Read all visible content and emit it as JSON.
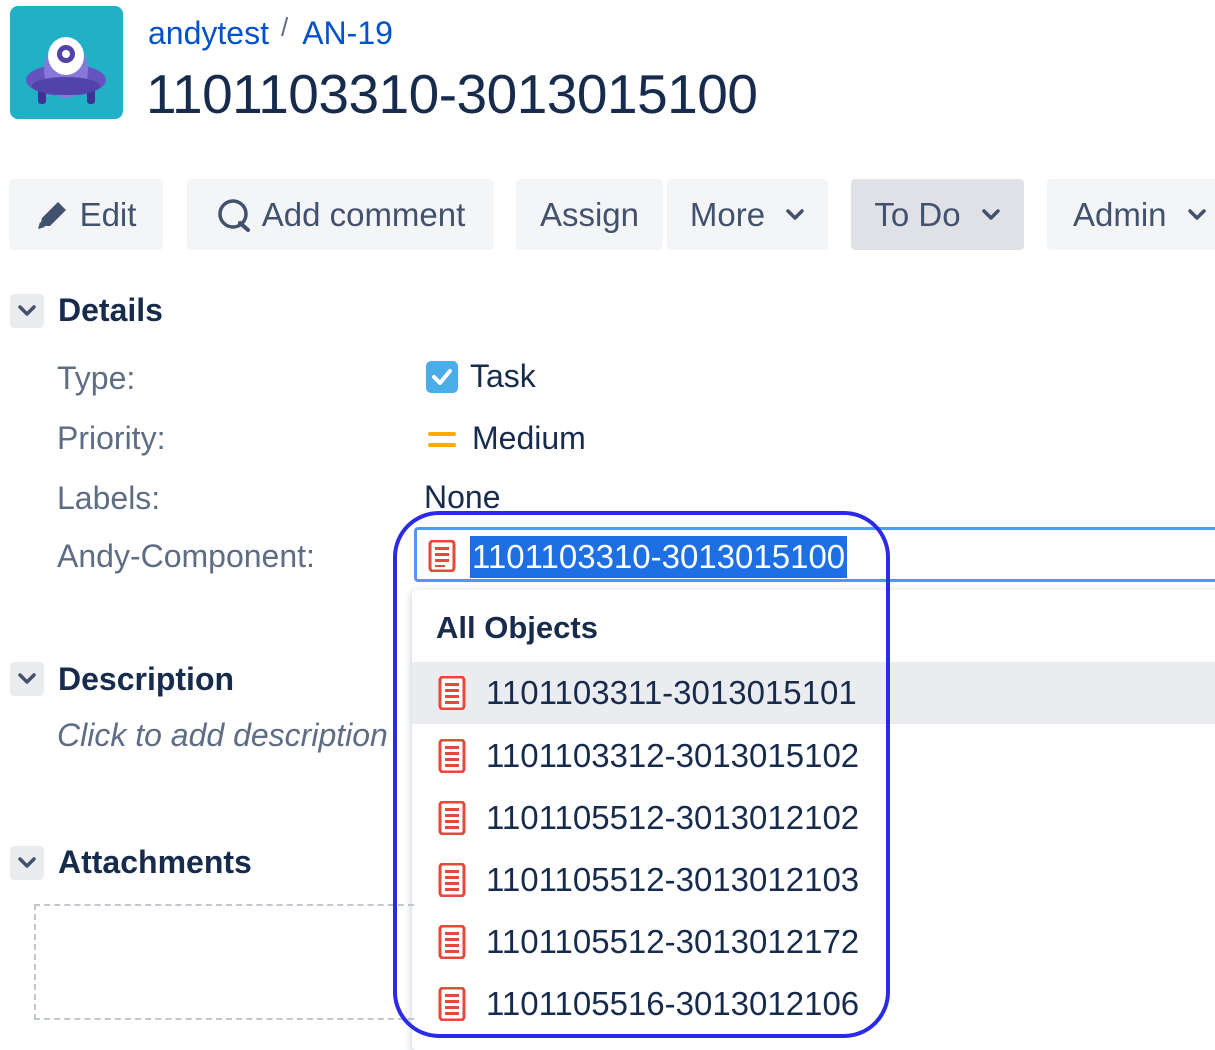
{
  "breadcrumb": {
    "project": "andytest",
    "separator": "/",
    "issue_key": "AN-19"
  },
  "issue": {
    "title": "1101103310-3013015100"
  },
  "toolbar": {
    "edit": "Edit",
    "add_comment": "Add comment",
    "assign": "Assign",
    "more": "More",
    "status": "To Do",
    "admin": "Admin"
  },
  "details": {
    "heading": "Details",
    "fields": [
      {
        "label": "Type:",
        "value": "Task"
      },
      {
        "label": "Priority:",
        "value": "Medium"
      },
      {
        "label": "Labels:",
        "value": "None"
      },
      {
        "label": "Andy-Component:",
        "value": "1101103310-3013015100"
      }
    ]
  },
  "description": {
    "heading": "Description",
    "placeholder": "Click to add description"
  },
  "attachments": {
    "heading": "Attachments"
  },
  "dropdown": {
    "heading": "All Objects",
    "options": [
      "1101103311-3013015101",
      "1101103312-3013015102",
      "1101105512-3013012102",
      "1101105512-3013012103",
      "1101105512-3013012172",
      "1101105516-3013012106"
    ],
    "highlighted_index": 0
  },
  "colors": {
    "link": "#0052cc",
    "selection": "#1e6fe3",
    "focus_border": "#4c9aff",
    "annotation_ring": "#2a2ae8",
    "priority_medium": "#ffab00",
    "task_icon": "#4bade8",
    "object_icon": "#e5493a",
    "avatar_bg": "#21b1c6"
  }
}
